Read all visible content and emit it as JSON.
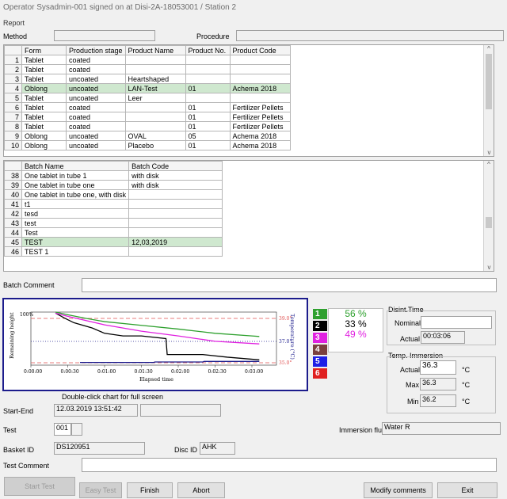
{
  "window": {
    "title": "Operator Sysadmin-001 signed on at Disi-2A-18053001 / Station 2"
  },
  "menu": {
    "report": "Report"
  },
  "method_row": {
    "method_label": "Method",
    "method_value": "",
    "procedure_label": "Procedure",
    "procedure_value": ""
  },
  "product_table": {
    "headers": [
      "Form",
      "Production stage",
      "Product Name",
      "Product No.",
      "Product Code"
    ],
    "rows": [
      {
        "n": "1",
        "form": "Tablet",
        "stage": "coated",
        "name": "",
        "no": "",
        "code": ""
      },
      {
        "n": "2",
        "form": "Tablet",
        "stage": "coated",
        "name": "",
        "no": "",
        "code": ""
      },
      {
        "n": "3",
        "form": "Tablet",
        "stage": "uncoated",
        "name": "Heartshaped",
        "no": "",
        "code": ""
      },
      {
        "n": "4",
        "form": "Oblong",
        "stage": "uncoated",
        "name": "LAN-Test",
        "no": "01",
        "code": "Achema 2018"
      },
      {
        "n": "5",
        "form": "Tablet",
        "stage": "uncoated",
        "name": "Leer",
        "no": "",
        "code": ""
      },
      {
        "n": "6",
        "form": "Tablet",
        "stage": "coated",
        "name": "",
        "no": "01",
        "code": "Fertilizer Pellets"
      },
      {
        "n": "7",
        "form": "Tablet",
        "stage": "coated",
        "name": "",
        "no": "01",
        "code": "Fertilizer Pellets"
      },
      {
        "n": "8",
        "form": "Tablet",
        "stage": "coated",
        "name": "",
        "no": "01",
        "code": "Fertilizer Pellets"
      },
      {
        "n": "9",
        "form": "Oblong",
        "stage": "uncoated",
        "name": "OVAL",
        "no": "05",
        "code": "Achema 2018"
      },
      {
        "n": "10",
        "form": "Oblong",
        "stage": "uncoated",
        "name": "Placebo",
        "no": "01",
        "code": "Achema 2018"
      }
    ]
  },
  "batch_table": {
    "headers": [
      "Batch Name",
      "Batch Code"
    ],
    "rows": [
      {
        "n": "38",
        "name": "One tablet in tube 1",
        "code": "with disk"
      },
      {
        "n": "39",
        "name": "One tablet in tube one",
        "code": "with disk"
      },
      {
        "n": "40",
        "name": "One tablet in tube one, with disk",
        "code": ""
      },
      {
        "n": "41",
        "name": "t1",
        "code": ""
      },
      {
        "n": "42",
        "name": "tesd",
        "code": ""
      },
      {
        "n": "43",
        "name": "test",
        "code": ""
      },
      {
        "n": "44",
        "name": "Test",
        "code": ""
      },
      {
        "n": "45",
        "name": "TEST",
        "code": "12,03,2019"
      },
      {
        "n": "46",
        "name": "TEST 1",
        "code": ""
      }
    ]
  },
  "batch_comment": {
    "label": "Batch Comment",
    "value": ""
  },
  "chart_data": {
    "type": "line",
    "xlabel": "Elapsed time",
    "ylabel_left": "Remaining height",
    "ylabel_right": "Temperature (°C)",
    "y_top_label": "100%",
    "x_ticks": [
      "0:00:00",
      "0:00:30",
      "0:01:00",
      "0:01:30",
      "0:02:00",
      "0:02:30",
      "0:03:00"
    ],
    "temp_ticks": [
      "39.0°",
      "37.0°",
      "35.0°"
    ],
    "x_range_seconds": [
      0,
      200
    ],
    "series": [
      {
        "name": "1",
        "color": "#2ea02e",
        "x": [
          20,
          30,
          45,
          60,
          90,
          120,
          150,
          180,
          186
        ],
        "y": [
          100,
          95,
          88,
          82,
          75,
          68,
          60,
          55,
          54
        ]
      },
      {
        "name": "2",
        "color": "#000000",
        "x": [
          20,
          28,
          35,
          50,
          60,
          75,
          90,
          110,
          111,
          140,
          160,
          186
        ],
        "y": [
          98,
          88,
          80,
          70,
          60,
          55,
          55,
          50,
          20,
          20,
          15,
          10
        ]
      },
      {
        "name": "3",
        "color": "#e020e0",
        "x": [
          20,
          30,
          45,
          60,
          90,
          120,
          150,
          186
        ],
        "y": [
          98,
          92,
          84,
          76,
          64,
          55,
          45,
          40
        ]
      },
      {
        "name": "5",
        "color": "#1c1c8c",
        "x": [
          40,
          100,
          101,
          140,
          141,
          186
        ],
        "y": [
          5,
          5,
          6,
          6,
          7,
          7
        ]
      }
    ],
    "temp_lines": [
      {
        "label": "39.0°",
        "color": "#e05050",
        "style": "dashed"
      },
      {
        "label": "37.0°",
        "color": "#1c1c8c",
        "style": "dotted"
      },
      {
        "label": "35.0°",
        "color": "#e05050",
        "style": "dashed"
      }
    ],
    "hint": "Double-click chart for full screen"
  },
  "tubes": [
    {
      "n": "1",
      "color": "#2ea02e",
      "pct": "56 %",
      "pct_color": "#2ea02e"
    },
    {
      "n": "2",
      "color": "#000000",
      "pct": "33 %",
      "pct_color": "#000000"
    },
    {
      "n": "3",
      "color": "#e020e0",
      "pct": "49 %",
      "pct_color": "#e020e0"
    },
    {
      "n": "4",
      "color": "#7a3f3f",
      "pct": "",
      "pct_color": "#000"
    },
    {
      "n": "5",
      "color": "#1e1ee6",
      "pct": "",
      "pct_color": "#000"
    },
    {
      "n": "6",
      "color": "#e02020",
      "pct": "",
      "pct_color": "#000"
    }
  ],
  "disint": {
    "title": "Disint.Time",
    "nominal_label": "Nominal",
    "nominal_value": "",
    "actual_label": "Actual",
    "actual_value": "00:03:06"
  },
  "temp": {
    "title": "Temp. Immersion",
    "actual_label": "Actual",
    "actual_value": "36.3",
    "max_label": "Max",
    "max_value": "36.3",
    "min_label": "Min",
    "min_value": "36.2",
    "unit": "°C"
  },
  "start_end": {
    "label": "Start-End",
    "start": "12.03.2019  13:51:42",
    "end": ""
  },
  "test": {
    "label": "Test",
    "value": "001"
  },
  "immersion": {
    "label": "Immersion fluid",
    "value": "Water R"
  },
  "basket": {
    "label": "Basket ID",
    "value": "DS120951"
  },
  "disc": {
    "label": "Disc ID",
    "value": "AHK"
  },
  "test_comment": {
    "label": "Test Comment",
    "value": ""
  },
  "buttons": {
    "start": "Start Test",
    "easy": "Easy Test",
    "finish": "Finish",
    "abort": "Abort",
    "modify": "Modify comments",
    "exit": "Exit"
  }
}
